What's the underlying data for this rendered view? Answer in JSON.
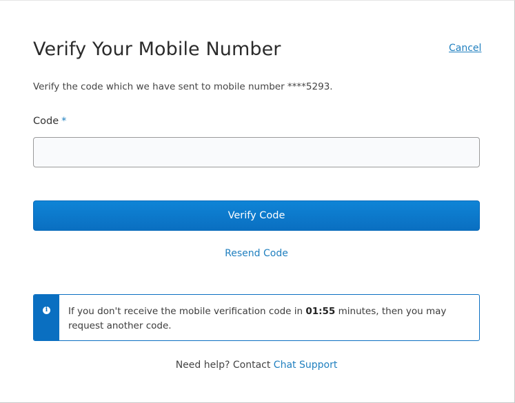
{
  "dialog": {
    "title": "Verify Your Mobile Number",
    "cancel_label": "Cancel",
    "description": "Verify the code which we have sent to mobile number ****5293."
  },
  "form": {
    "code_label": "Code",
    "required_marker": "*",
    "code_value": "",
    "code_placeholder": "",
    "verify_button_label": "Verify Code",
    "resend_label": "Resend Code"
  },
  "info": {
    "icon": "info-icon",
    "text_before": "If you don't receive the mobile verification code in ",
    "countdown": "01:55",
    "text_after": " minutes, then you may request another code."
  },
  "help": {
    "prefix": "Need help? Contact ",
    "link_label": "Chat Support"
  },
  "colors": {
    "accent": "#0a6fc1",
    "link": "#1f7fbf"
  }
}
